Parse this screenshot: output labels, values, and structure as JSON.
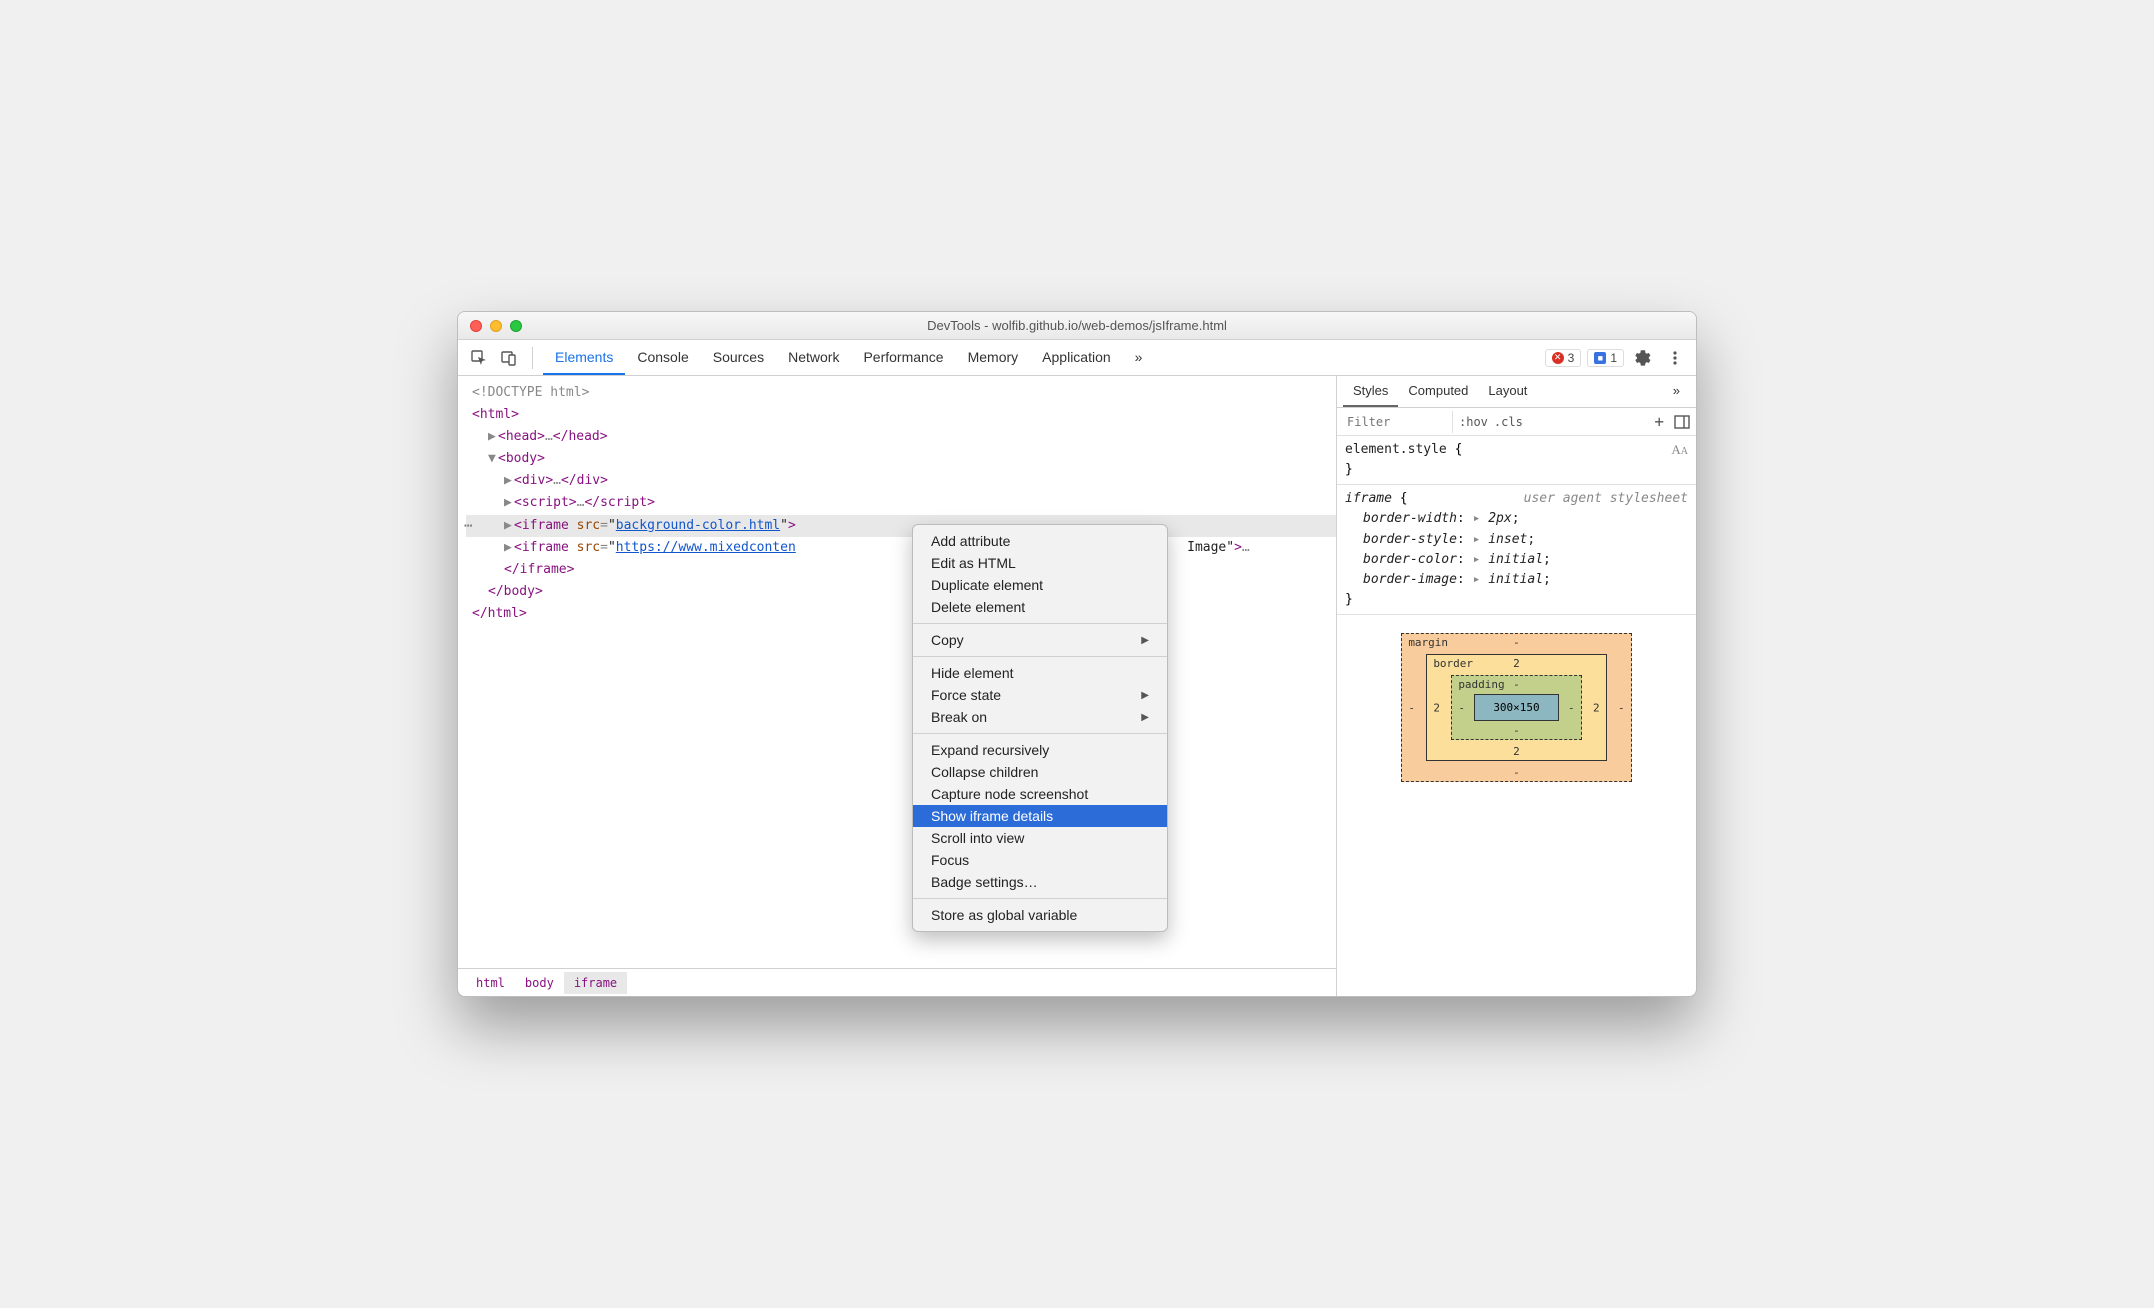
{
  "window": {
    "title": "DevTools - wolfib.github.io/web-demos/jsIframe.html"
  },
  "mainTabs": {
    "items": [
      "Elements",
      "Console",
      "Sources",
      "Network",
      "Performance",
      "Memory",
      "Application"
    ],
    "overflow": "»",
    "activeIndex": 0
  },
  "statusBadges": {
    "errors": "3",
    "issues": "1"
  },
  "domTree": {
    "doctype": "<!DOCTYPE html>",
    "htmlOpen": "html",
    "headOpen": "head",
    "headClose": "head",
    "headEllipsis": "…",
    "bodyOpen": "body",
    "divOpen": "div",
    "divClose": "div",
    "divEllipsis": "…",
    "scriptOpen": "script",
    "scriptClose": "script",
    "scriptEllipsis": "…",
    "iframe1": {
      "tag": "iframe",
      "attr": "src",
      "val": "background-color.html"
    },
    "iframe2": {
      "tag": "iframe",
      "attr": "src",
      "val": "https://www.mixedconten",
      "trailAttr": "Image",
      "trailEllipsis": "…",
      "close": "iframe"
    },
    "bodyClose": "body",
    "htmlClose": "html"
  },
  "breadcrumb": [
    "html",
    "body",
    "iframe"
  ],
  "contextMenu": {
    "group1": [
      "Add attribute",
      "Edit as HTML",
      "Duplicate element",
      "Delete element"
    ],
    "group2": [
      {
        "label": "Copy",
        "sub": true
      }
    ],
    "group3": [
      {
        "label": "Hide element"
      },
      {
        "label": "Force state",
        "sub": true
      },
      {
        "label": "Break on",
        "sub": true
      }
    ],
    "group4": [
      "Expand recursively",
      "Collapse children",
      "Capture node screenshot",
      "Show iframe details",
      "Scroll into view",
      "Focus",
      "Badge settings…"
    ],
    "highlighted": "Show iframe details",
    "group5": [
      "Store as global variable"
    ]
  },
  "stylesPane": {
    "tabs": [
      "Styles",
      "Computed",
      "Layout"
    ],
    "overflow": "»",
    "filterPlaceholder": "Filter",
    "hov": ":hov",
    "cls": ".cls",
    "elementStyle": {
      "selector": "element.style",
      "open": "{",
      "close": "}"
    },
    "uaRule": {
      "selector": "iframe",
      "open": "{",
      "close": "}",
      "source": "user agent stylesheet",
      "decls": [
        {
          "prop": "border-width",
          "val": "2px"
        },
        {
          "prop": "border-style",
          "val": "inset"
        },
        {
          "prop": "border-color",
          "val": "initial"
        },
        {
          "prop": "border-image",
          "val": "initial"
        }
      ]
    }
  },
  "boxModel": {
    "marginLabel": "margin",
    "margin": {
      "t": "-",
      "r": "-",
      "b": "-",
      "l": "-"
    },
    "borderLabel": "border",
    "border": {
      "t": "2",
      "r": "2",
      "b": "2",
      "l": "2"
    },
    "paddingLabel": "padding",
    "padding": {
      "t": "-",
      "r": "-",
      "b": "-",
      "l": "-"
    },
    "content": "300×150"
  }
}
